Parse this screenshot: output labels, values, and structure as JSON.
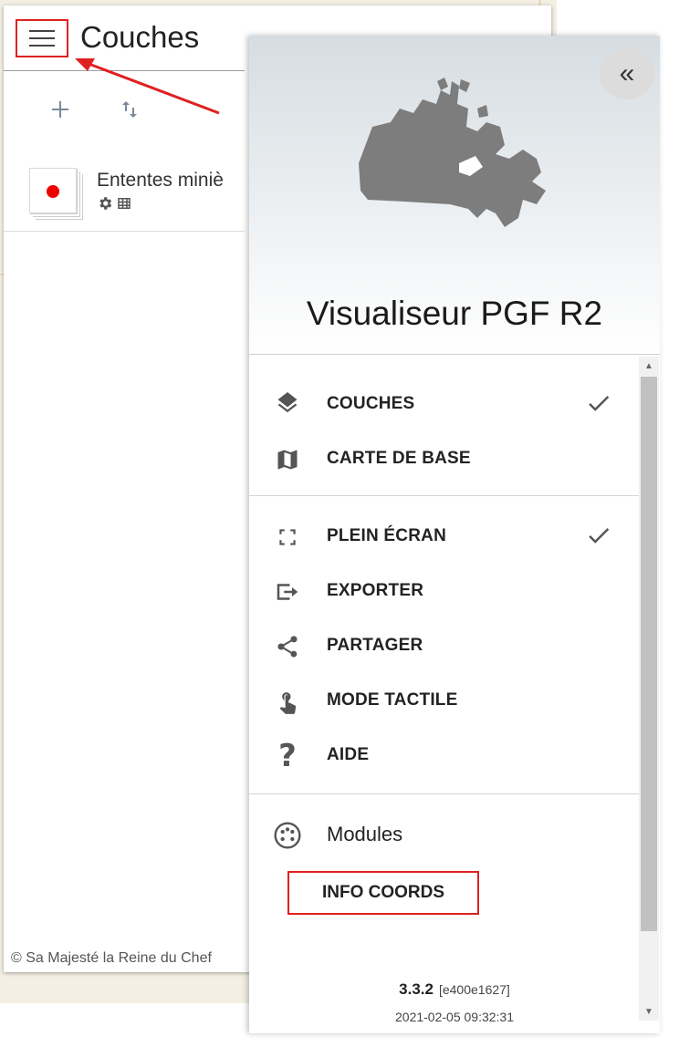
{
  "layers_panel": {
    "title": "Couches",
    "layer": {
      "name": "Ententes miniè",
      "dot_color": "#e00000"
    },
    "footer": "© Sa Majesté la Reine du Chef"
  },
  "drawer": {
    "app_title": "Visualiseur PGF R2",
    "sections": [
      {
        "items": [
          {
            "label": "COUCHES",
            "icon": "layers-icon",
            "checked": true
          },
          {
            "label": "CARTE DE BASE",
            "icon": "map-icon",
            "checked": false
          }
        ]
      },
      {
        "items": [
          {
            "label": "PLEIN ÉCRAN",
            "icon": "fullscreen-icon",
            "checked": true
          },
          {
            "label": "EXPORTER",
            "icon": "export-icon",
            "checked": false
          },
          {
            "label": "PARTAGER",
            "icon": "share-icon",
            "checked": false
          },
          {
            "label": "MODE TACTILE",
            "icon": "touch-icon",
            "checked": false
          },
          {
            "label": "AIDE",
            "icon": "help-icon",
            "checked": false
          }
        ]
      }
    ],
    "modules": {
      "label": "Modules",
      "items": [
        {
          "label": "INFO COORDS"
        }
      ]
    },
    "version": "3.3.2",
    "hash": "[e400e1627]",
    "build_date": "2021-02-05 09:32:31"
  },
  "colors": {
    "highlight": "#e02020",
    "icon_gray": "#555555",
    "accent_gray": "#7a8a99"
  }
}
